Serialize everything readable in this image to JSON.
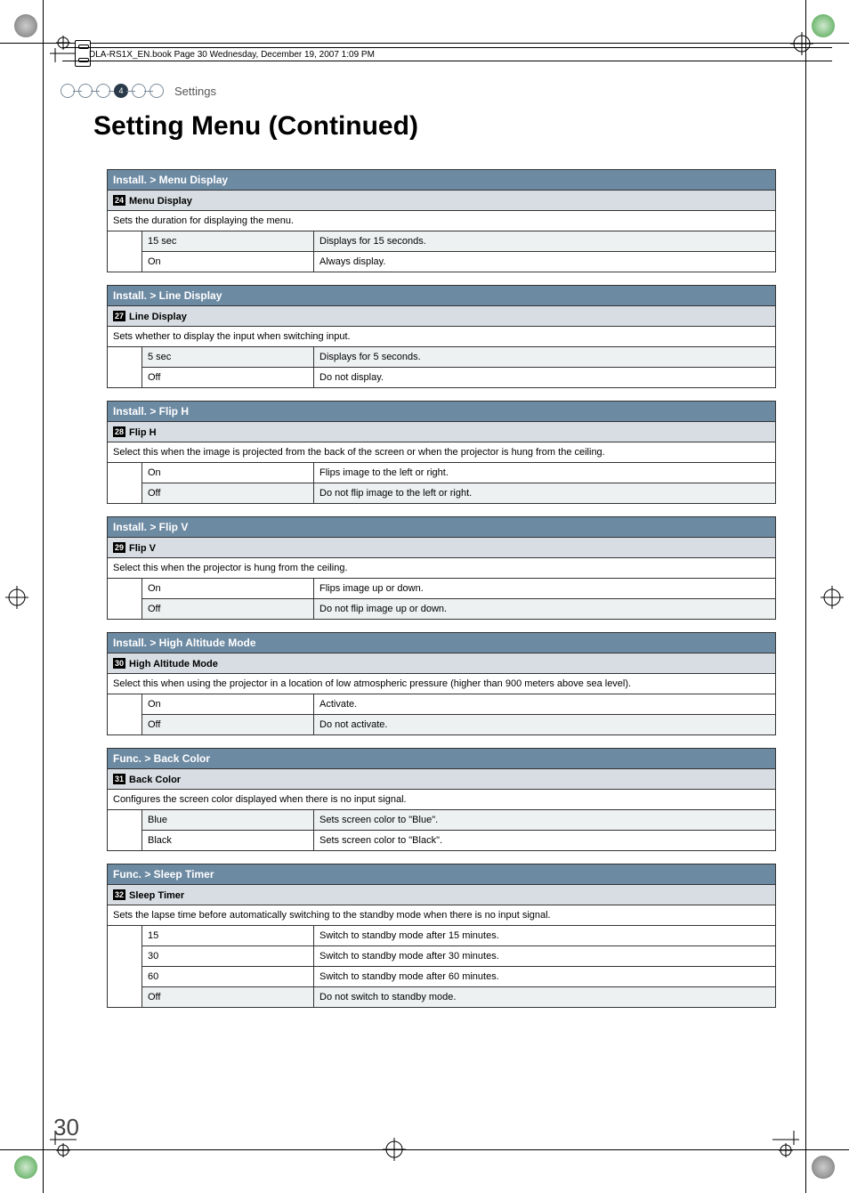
{
  "header_text": "DLA-RS1X_EN.book  Page 30  Wednesday, December 19, 2007  1:09 PM",
  "chapter_number": "4",
  "chapter_label": "Settings",
  "page_title": "Setting Menu (Continued)",
  "page_number": "30",
  "sections": [
    {
      "header": "Install. > Menu Display",
      "sub_num": "24",
      "sub_title": "Menu Display",
      "desc": "Sets the duration for displaying the menu.",
      "rows": [
        {
          "opt": "15 sec",
          "val": "Displays for 15 seconds.",
          "shade": true
        },
        {
          "opt": "On",
          "val": "Always display.",
          "shade": false
        }
      ]
    },
    {
      "header": "Install. > Line Display",
      "sub_num": "27",
      "sub_title": "Line Display",
      "desc": "Sets whether to display the input when switching input.",
      "rows": [
        {
          "opt": "5 sec",
          "val": "Displays for 5 seconds.",
          "shade": true
        },
        {
          "opt": "Off",
          "val": "Do not display.",
          "shade": false
        }
      ]
    },
    {
      "header": "Install. > Flip H",
      "sub_num": "28",
      "sub_title": "Flip H",
      "desc": "Select this when the image is projected from the back of the screen or when the projector is hung from the ceiling.",
      "rows": [
        {
          "opt": "On",
          "val": "Flips image to the left or right.",
          "shade": false
        },
        {
          "opt": "Off",
          "val": "Do not flip image to the left or right.",
          "shade": true
        }
      ]
    },
    {
      "header": "Install. > Flip V",
      "sub_num": "29",
      "sub_title": "Flip V",
      "desc": "Select this when the projector is hung from the ceiling.",
      "rows": [
        {
          "opt": "On",
          "val": "Flips image up or down.",
          "shade": false
        },
        {
          "opt": "Off",
          "val": "Do not flip image up or down.",
          "shade": true
        }
      ]
    },
    {
      "header": "Install. > High Altitude Mode",
      "sub_num": "30",
      "sub_title": "High Altitude Mode",
      "desc": "Select this when using the projector in a location of low atmospheric pressure (higher than 900 meters above sea level).",
      "rows": [
        {
          "opt": "On",
          "val": "Activate.",
          "shade": false
        },
        {
          "opt": "Off",
          "val": "Do not activate.",
          "shade": true
        }
      ]
    },
    {
      "header": "Func. > Back Color",
      "sub_num": "31",
      "sub_title": "Back Color",
      "desc": "Configures the screen color displayed when there is no input signal.",
      "rows": [
        {
          "opt": "Blue",
          "val": "Sets screen color to \"Blue\".",
          "shade": true
        },
        {
          "opt": "Black",
          "val": "Sets screen color to \"Black\".",
          "shade": false
        }
      ]
    },
    {
      "header": "Func. > Sleep Timer",
      "sub_num": "32",
      "sub_title": "Sleep Timer",
      "desc": "Sets the lapse time before automatically switching to the standby mode when there is no input signal.",
      "rows": [
        {
          "opt": "15",
          "val": "Switch to standby mode after 15 minutes.",
          "shade": false
        },
        {
          "opt": "30",
          "val": "Switch to standby mode after 30 minutes.",
          "shade": false
        },
        {
          "opt": "60",
          "val": "Switch to standby mode after 60 minutes.",
          "shade": false
        },
        {
          "opt": "Off",
          "val": "Do not switch to standby mode.",
          "shade": true
        }
      ]
    }
  ]
}
